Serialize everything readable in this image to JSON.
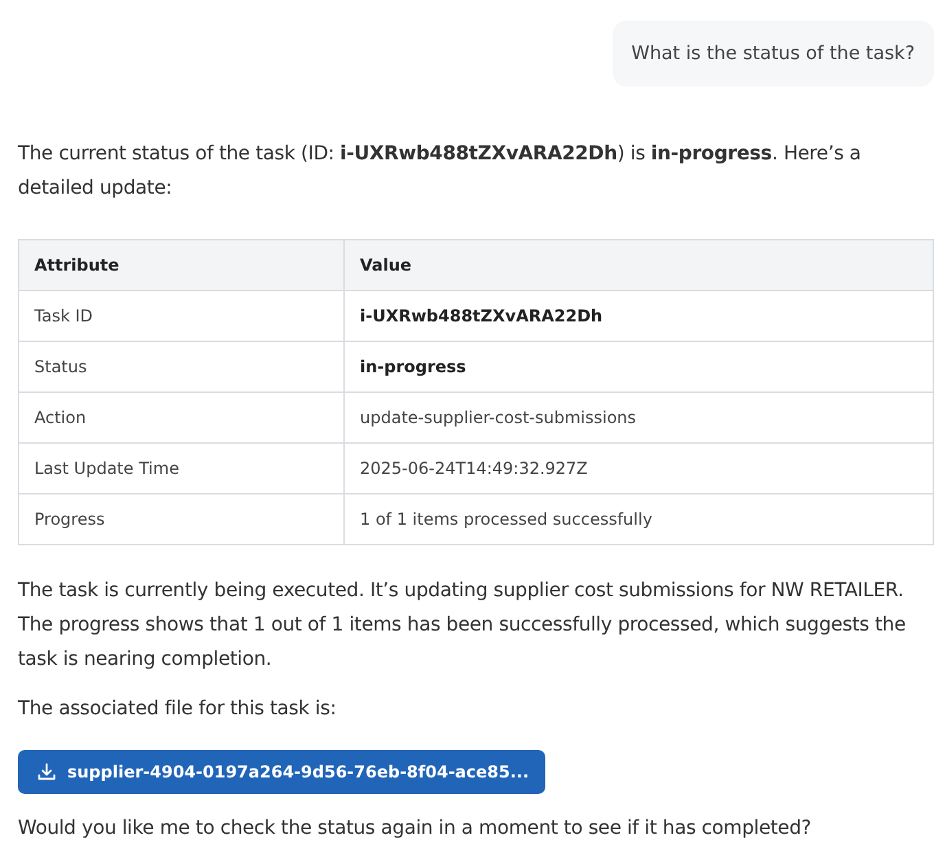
{
  "user_message": {
    "text": "What is the status of the task?"
  },
  "intro": "The current status of the task (ID: **i-UXRwb488tZXvARA22Dh**) is **in-progress**. Here’s a detailed update:",
  "table": {
    "columns": [
      "Attribute",
      "Value"
    ],
    "rows": [
      {
        "attribute": "Task ID",
        "value": "i-UXRwb488tZXvARA22Dh",
        "bold": true
      },
      {
        "attribute": "Status",
        "value": "in-progress",
        "bold": true
      },
      {
        "attribute": "Action",
        "value": "update-supplier-cost-submissions",
        "bold": false
      },
      {
        "attribute": "Last Update Time",
        "value": "2025-06-24T14:49:32.927Z",
        "bold": false
      },
      {
        "attribute": "Progress",
        "value": "1 of 1 items processed successfully",
        "bold": false
      }
    ]
  },
  "summary": "The task is currently being executed. It’s updating supplier cost submissions for NW RETAILER. The progress shows that 1 out of 1 items has been successfully processed, which suggests the task is nearing completion.",
  "file_intro": "The associated file for this task is:",
  "file_button": {
    "label": "supplier-4904-0197a264-9d56-76eb-8f04-ace85..."
  },
  "closing": "Would you like me to check the status again in a moment to see if it has completed?"
}
